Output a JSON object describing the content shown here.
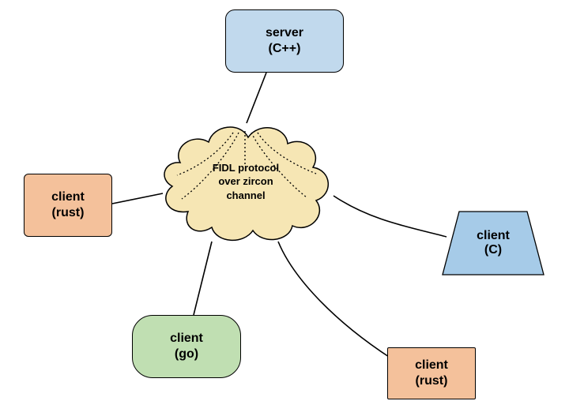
{
  "nodes": {
    "server": {
      "line1": "server",
      "line2": "(C++)"
    },
    "rust1": {
      "line1": "client",
      "line2": "(rust)"
    },
    "go": {
      "line1": "client",
      "line2": "(go)"
    },
    "rust2": {
      "line1": "client",
      "line2": "(rust)"
    },
    "c": {
      "line1": "client",
      "line2": "(C)"
    },
    "cloud": {
      "line1": "FIDL protocol",
      "line2": "over zircon",
      "line3": "channel"
    }
  },
  "colors": {
    "server": "#c1d9ed",
    "rust": "#f4c19b",
    "go": "#c0dfb2",
    "cloud": "#f6e6b4",
    "c": "#a6cbe8"
  }
}
